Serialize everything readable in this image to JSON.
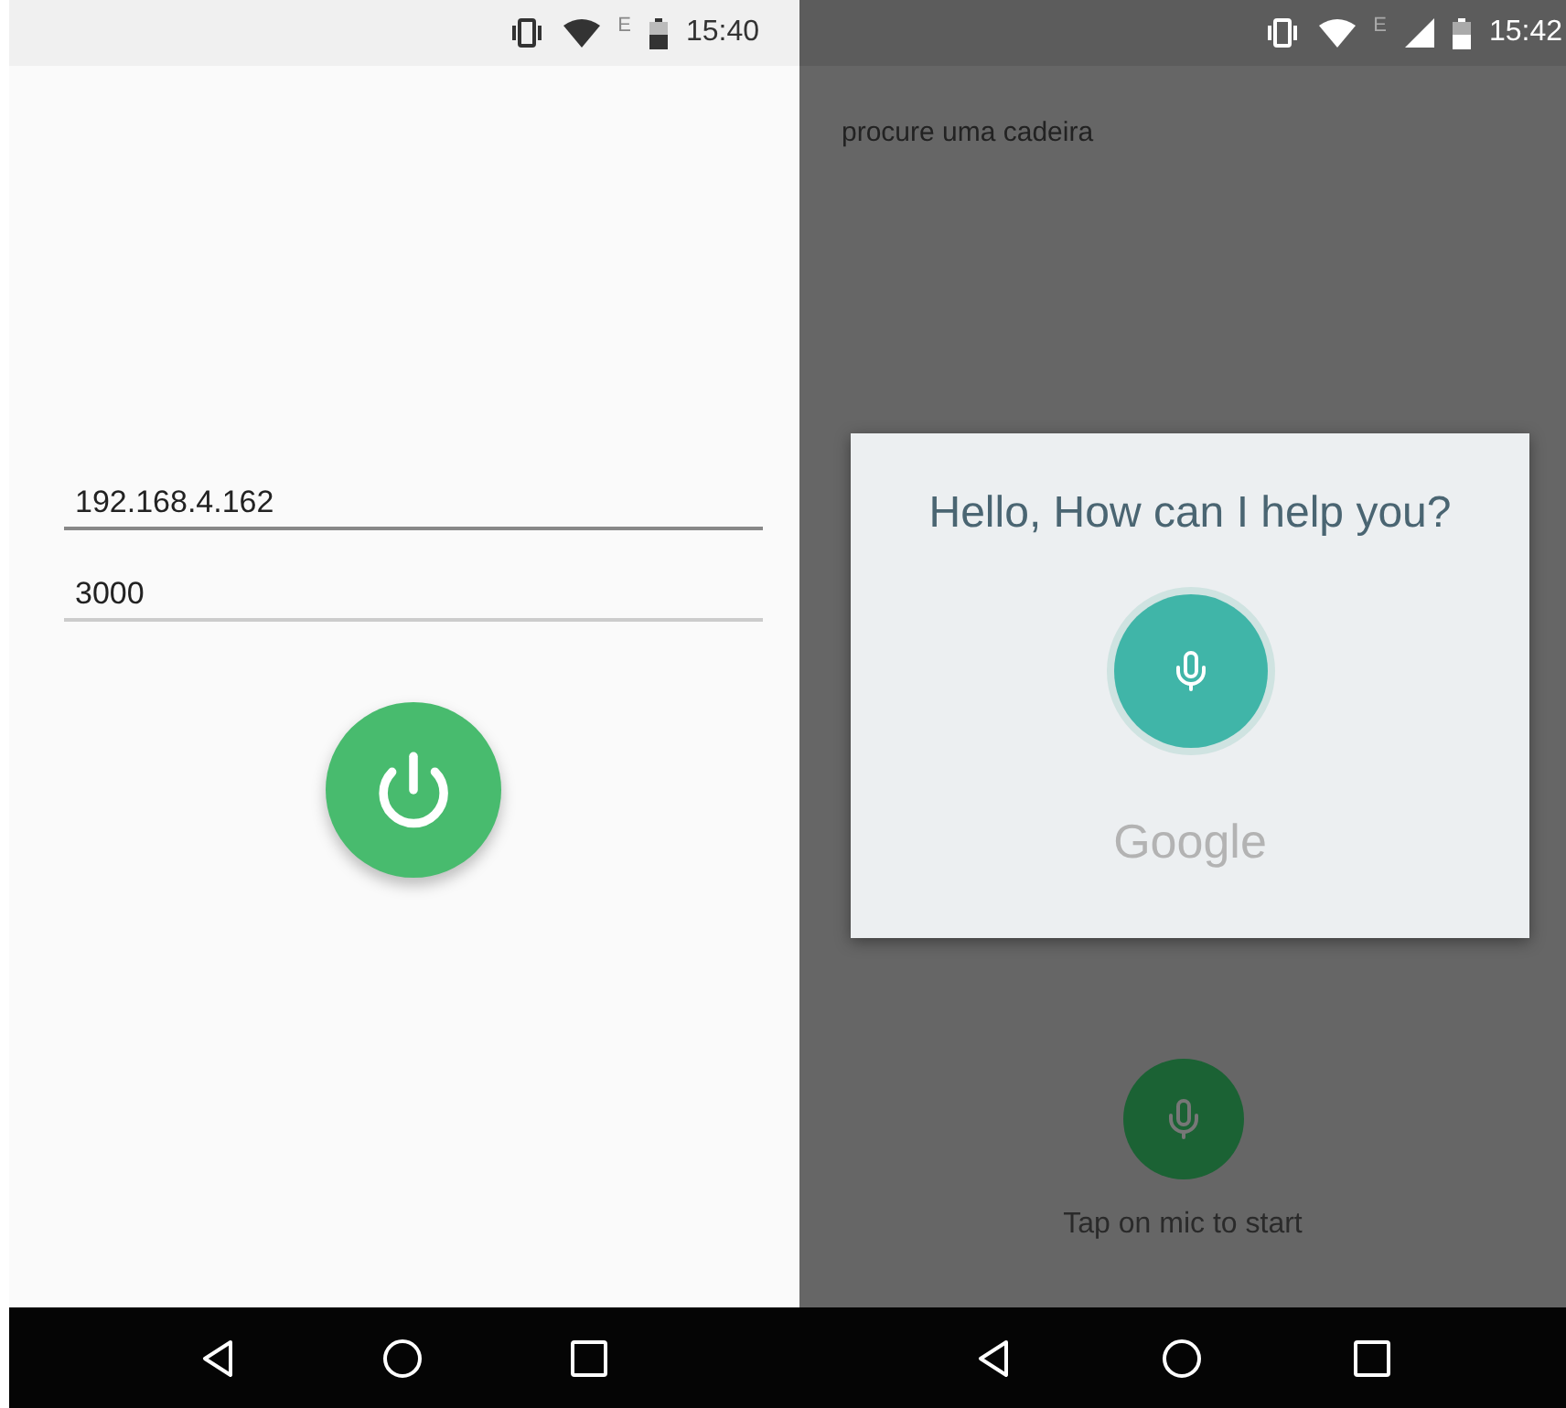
{
  "phones": [
    {
      "kind": "connect",
      "status_bar": {
        "network": "E",
        "signal": false,
        "time": "15:40"
      },
      "fields": [
        {
          "value": "192.168.4.162",
          "focused": true
        },
        {
          "value": "3000",
          "focused": false
        }
      ]
    },
    {
      "kind": "voice",
      "status_bar": {
        "network": "E",
        "signal": true,
        "time": "15:42"
      },
      "query": "procure uma cadeira",
      "dialog": {
        "title": "Hello, How can I help you?",
        "brand": "Google"
      },
      "hint": "Tap on mic to start"
    }
  ]
}
